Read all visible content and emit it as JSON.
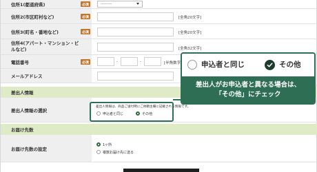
{
  "form": {
    "required_badge": "必須",
    "rows": [
      {
        "label": "住所1(都道府県)",
        "select_value": "---------"
      },
      {
        "label": "住所2(市区町村など)",
        "hint": "[全角20文字]"
      },
      {
        "label": "住所3(町名・番地など)",
        "hint": "[全角20文字]"
      },
      {
        "label": "住所4(アパート・マンション・ビルなど)",
        "hint": "[全角32文字]"
      },
      {
        "label": "電話番号",
        "separator1": "-",
        "separator2": "-",
        "hint": "[半角数字]"
      },
      {
        "label": "メールアドレス"
      }
    ]
  },
  "sender_section": {
    "title": "差出人情報",
    "row_label": "差出人情報の選択",
    "note": "差出人情報は、商品ご送付時にご依頼主欄に記載される情報です。",
    "option_same": "申込者と同じ",
    "option_other": "その他"
  },
  "delivery_section": {
    "title": "お届け先数",
    "row_label": "お届け先数の設定",
    "option_one": "1ヶ所",
    "option_multiple": "複数お届け先に送る"
  },
  "callout": {
    "option_same": "申込者と同じ",
    "option_other": "その他",
    "text_line1": "差出人がお申込者と異なる場合は、",
    "text_line2": "「その他」にチェック"
  },
  "colors": {
    "accent": "#2e6e54",
    "required": "#c0772b",
    "section_bg": "#dfeac6"
  }
}
